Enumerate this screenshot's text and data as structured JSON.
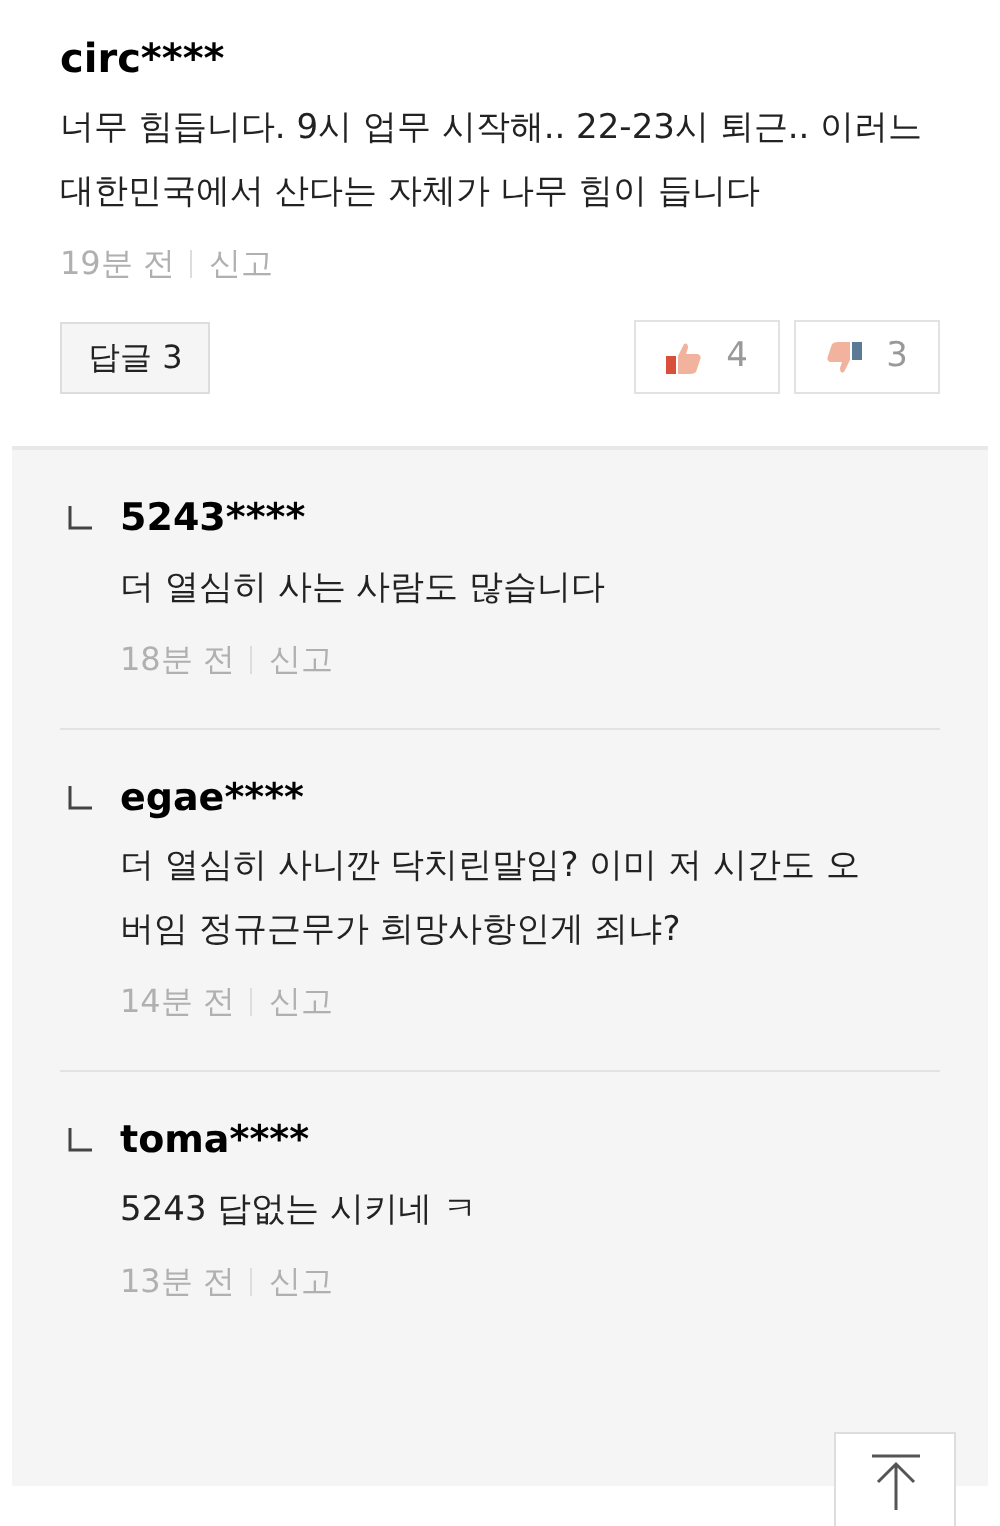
{
  "comment": {
    "author": "circ****",
    "body": "너무 힘듭니다. 9시 업무 시작해.. 22-23시 퇴근.. 이러느대한민국에서 산다는 자체가 나무 힘이 듭니다",
    "time": "19분 전",
    "report": "신고",
    "reply_button": "답글 3",
    "likes": "4",
    "dislikes": "3"
  },
  "replies": [
    {
      "author": "5243****",
      "body": "더 열심히 사는 사람도 많습니다",
      "time": "18분 전",
      "report": "신고"
    },
    {
      "author": "egae****",
      "body": "더 열심히 사니깐 닥치린말임? 이미 저 시간도 오버임 정규근무가 희망사항인게 죄냐?",
      "time": "14분 전",
      "report": "신고"
    },
    {
      "author": "toma****",
      "body": "5243 답없는 시키네 ㅋ",
      "time": "13분 전",
      "report": "신고"
    }
  ]
}
